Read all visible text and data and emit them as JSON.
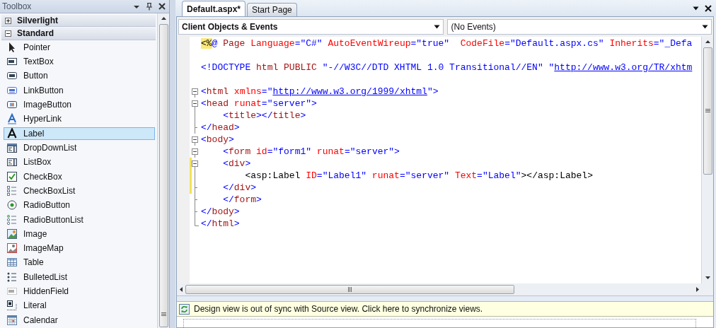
{
  "toolbox": {
    "title": "Toolbox",
    "groups": [
      {
        "label": "Silverlight",
        "expanded": false
      },
      {
        "label": "Standard",
        "expanded": true,
        "items": [
          {
            "label": "Pointer",
            "kind": "pointer",
            "selected": false
          },
          {
            "label": "TextBox",
            "kind": "textbox",
            "selected": false
          },
          {
            "label": "Button",
            "kind": "button",
            "selected": false
          },
          {
            "label": "LinkButton",
            "kind": "linkbutton",
            "selected": false
          },
          {
            "label": "ImageButton",
            "kind": "imagebutton",
            "selected": false
          },
          {
            "label": "HyperLink",
            "kind": "hyperlink",
            "selected": false
          },
          {
            "label": "Label",
            "kind": "label",
            "selected": true
          },
          {
            "label": "DropDownList",
            "kind": "dropdownlist",
            "selected": false
          },
          {
            "label": "ListBox",
            "kind": "listbox",
            "selected": false
          },
          {
            "label": "CheckBox",
            "kind": "checkbox",
            "selected": false
          },
          {
            "label": "CheckBoxList",
            "kind": "checkboxlist",
            "selected": false
          },
          {
            "label": "RadioButton",
            "kind": "radiobutton",
            "selected": false
          },
          {
            "label": "RadioButtonList",
            "kind": "radiobuttonlist",
            "selected": false
          },
          {
            "label": "Image",
            "kind": "image",
            "selected": false
          },
          {
            "label": "ImageMap",
            "kind": "imagemap",
            "selected": false
          },
          {
            "label": "Table",
            "kind": "table",
            "selected": false
          },
          {
            "label": "BulletedList",
            "kind": "bulletedlist",
            "selected": false
          },
          {
            "label": "HiddenField",
            "kind": "hiddenfield",
            "selected": false
          },
          {
            "label": "Literal",
            "kind": "literal",
            "selected": false
          },
          {
            "label": "Calendar",
            "kind": "calendar",
            "selected": false
          }
        ]
      }
    ]
  },
  "editor": {
    "tabs": [
      {
        "label": "Default.aspx*",
        "selected": true
      },
      {
        "label": "Start Page",
        "selected": false
      }
    ],
    "object_dropdown": {
      "value": "Client Objects & Events"
    },
    "event_dropdown": {
      "value": "(No Events)"
    },
    "lines": [
      {
        "kind": "plain",
        "tokens": [
          {
            "kind": "hl",
            "text": "<%"
          },
          {
            "kind": "delim",
            "text": "@ "
          },
          {
            "kind": "tag",
            "text": "Page "
          },
          {
            "kind": "attr",
            "text": "Language"
          },
          {
            "kind": "delim",
            "text": "=\"C#\" "
          },
          {
            "kind": "attr",
            "text": "AutoEventWireup"
          },
          {
            "kind": "delim",
            "text": "=\"true\"  "
          },
          {
            "kind": "attr",
            "text": "CodeFile"
          },
          {
            "kind": "delim",
            "text": "=\"Default.aspx.cs\" "
          },
          {
            "kind": "attr",
            "text": "Inherits"
          },
          {
            "kind": "delim",
            "text": "=\"_Defa"
          }
        ]
      },
      {
        "kind": "blank"
      },
      {
        "kind": "plain",
        "tokens": [
          {
            "kind": "delim",
            "text": "<!"
          },
          {
            "kind": "delim",
            "text": "DOCTYPE "
          },
          {
            "kind": "tag",
            "text": "html PUBLIC "
          },
          {
            "kind": "delim",
            "text": "\"-//W3C//DTD XHTML 1.0 Transitional//EN\" \""
          },
          {
            "kind": "link",
            "text": "http://www.w3.org/TR/xhtm"
          }
        ]
      },
      {
        "kind": "blank"
      },
      {
        "kind": "open",
        "tokens": [
          {
            "kind": "delim",
            "text": "<"
          },
          {
            "kind": "tag",
            "text": "html "
          },
          {
            "kind": "attr",
            "text": "xmlns"
          },
          {
            "kind": "delim",
            "text": "=\""
          },
          {
            "kind": "link",
            "text": "http://www.w3.org/1999/xhtml"
          },
          {
            "kind": "delim",
            "text": "\">"
          }
        ]
      },
      {
        "kind": "open",
        "tokens": [
          {
            "kind": "delim",
            "text": "<"
          },
          {
            "kind": "tag",
            "text": "head "
          },
          {
            "kind": "attr",
            "text": "runat"
          },
          {
            "kind": "delim",
            "text": "=\"server\">"
          }
        ]
      },
      {
        "kind": "inner",
        "tokens": [
          {
            "kind": "delim",
            "text": "    <"
          },
          {
            "kind": "tag",
            "text": "title"
          },
          {
            "kind": "delim",
            "text": "></"
          },
          {
            "kind": "tag",
            "text": "title"
          },
          {
            "kind": "delim",
            "text": ">"
          }
        ]
      },
      {
        "kind": "close",
        "tokens": [
          {
            "kind": "delim",
            "text": "</"
          },
          {
            "kind": "tag",
            "text": "head"
          },
          {
            "kind": "delim",
            "text": ">"
          }
        ]
      },
      {
        "kind": "open",
        "tokens": [
          {
            "kind": "delim",
            "text": "<"
          },
          {
            "kind": "tag",
            "text": "body"
          },
          {
            "kind": "delim",
            "text": ">"
          }
        ]
      },
      {
        "kind": "open",
        "tokens": [
          {
            "kind": "delim",
            "text": "    <"
          },
          {
            "kind": "tag",
            "text": "form "
          },
          {
            "kind": "attr",
            "text": "id"
          },
          {
            "kind": "delim",
            "text": "=\"form1\" "
          },
          {
            "kind": "attr",
            "text": "runat"
          },
          {
            "kind": "delim",
            "text": "=\"server\">"
          }
        ]
      },
      {
        "kind": "open",
        "modified": true,
        "tokens": [
          {
            "kind": "delim",
            "text": "    <"
          },
          {
            "kind": "tag",
            "text": "div"
          },
          {
            "kind": "delim",
            "text": ">"
          }
        ]
      },
      {
        "kind": "inner",
        "modified": true,
        "tokens": [
          {
            "kind": "server",
            "text": "        <asp:Label "
          },
          {
            "kind": "attr",
            "text": "ID"
          },
          {
            "kind": "delim",
            "text": "=\"Label1\" "
          },
          {
            "kind": "attr",
            "text": "runat"
          },
          {
            "kind": "delim",
            "text": "=\"server\" "
          },
          {
            "kind": "attr",
            "text": "Text"
          },
          {
            "kind": "delim",
            "text": "=\"Label\""
          },
          {
            "kind": "server",
            "text": "></asp:Label>"
          }
        ]
      },
      {
        "kind": "close",
        "modified": true,
        "tokens": [
          {
            "kind": "delim",
            "text": "    </"
          },
          {
            "kind": "tag",
            "text": "div"
          },
          {
            "kind": "delim",
            "text": ">"
          }
        ]
      },
      {
        "kind": "close",
        "tokens": [
          {
            "kind": "delim",
            "text": "    </"
          },
          {
            "kind": "tag",
            "text": "form"
          },
          {
            "kind": "delim",
            "text": ">"
          }
        ]
      },
      {
        "kind": "close",
        "tokens": [
          {
            "kind": "delim",
            "text": "</"
          },
          {
            "kind": "tag",
            "text": "body"
          },
          {
            "kind": "delim",
            "text": ">"
          }
        ]
      },
      {
        "kind": "last",
        "tokens": [
          {
            "kind": "delim",
            "text": "</"
          },
          {
            "kind": "tag",
            "text": "html"
          },
          {
            "kind": "delim",
            "text": ">"
          }
        ]
      }
    ]
  },
  "sync_bar": {
    "message": "Design view is out of sync with Source view. Click here to synchronize views."
  }
}
